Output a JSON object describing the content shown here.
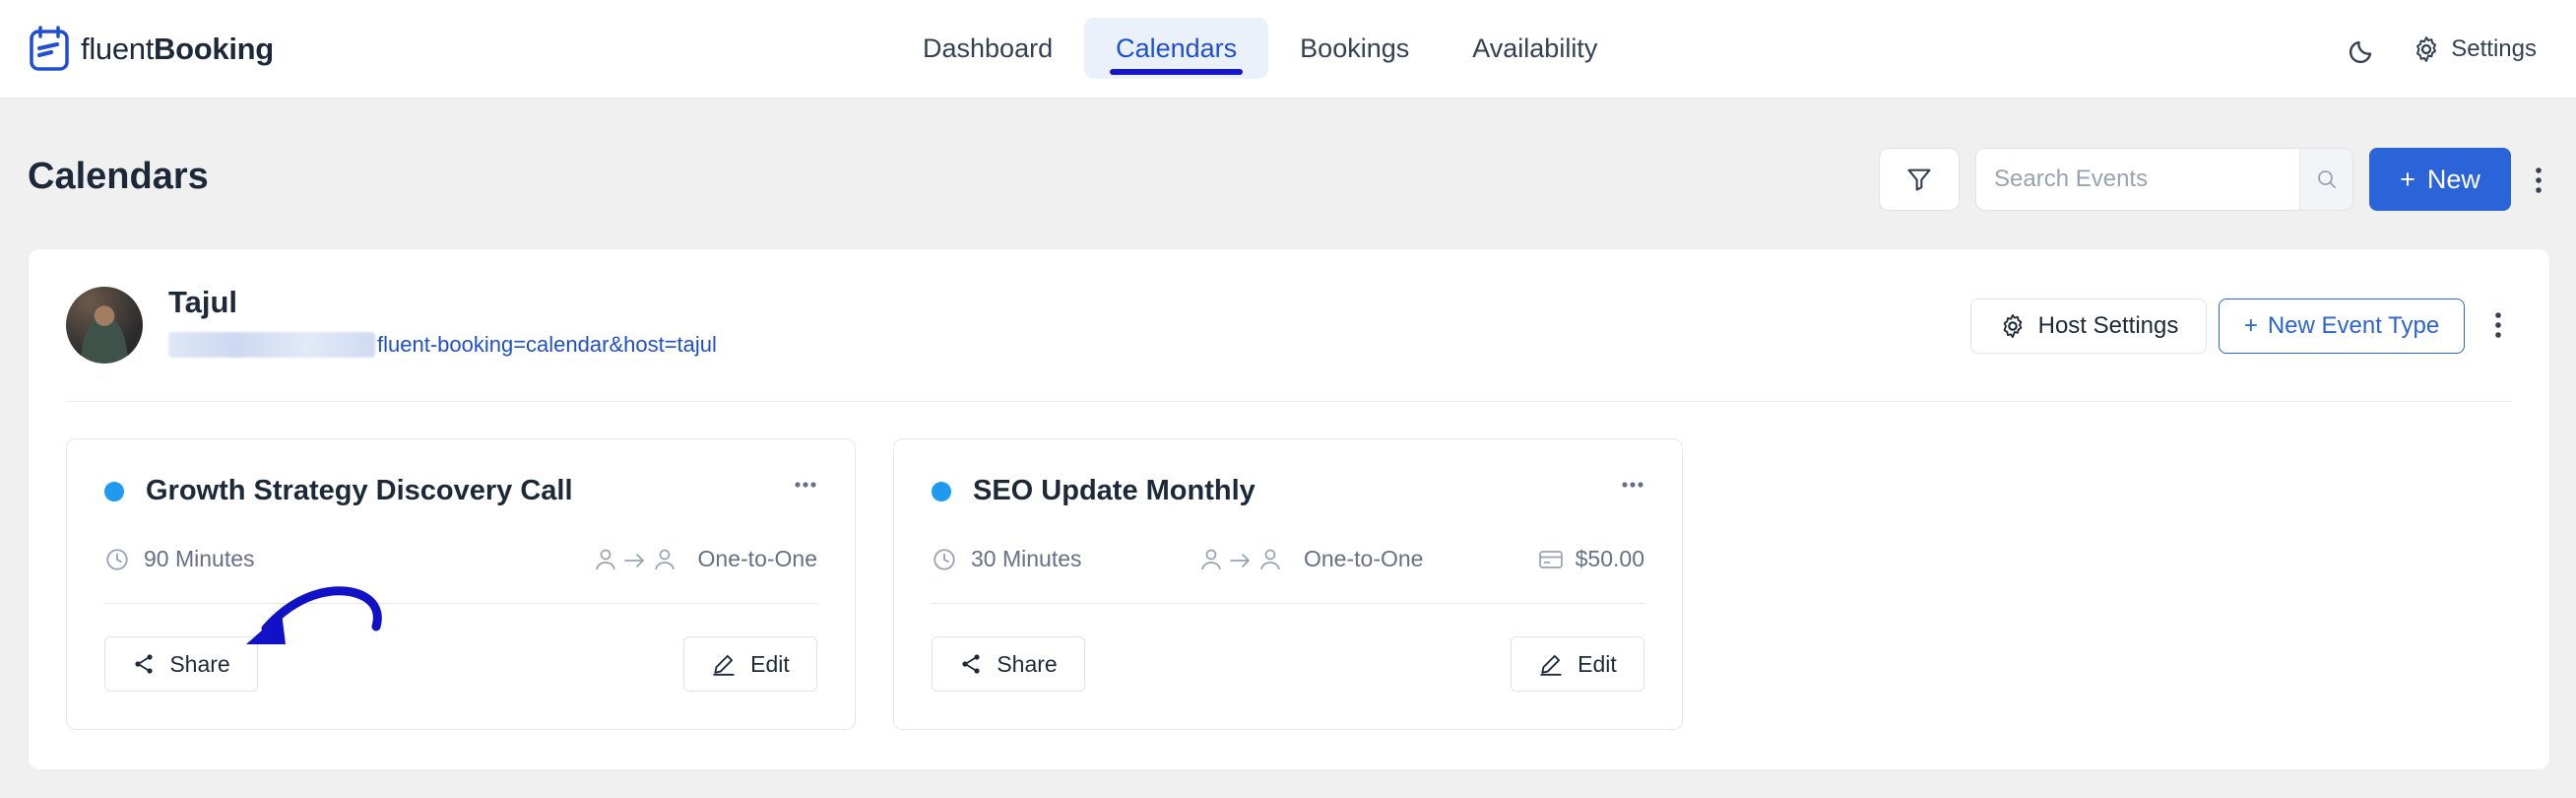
{
  "brand": {
    "light": "fluent",
    "bold": "Booking"
  },
  "nav": [
    {
      "label": "Dashboard",
      "active": false
    },
    {
      "label": "Calendars",
      "active": true
    },
    {
      "label": "Bookings",
      "active": false
    },
    {
      "label": "Availability",
      "active": false
    }
  ],
  "topbar": {
    "settings_label": "Settings",
    "theme_icon": "moon-icon"
  },
  "page": {
    "title": "Calendars",
    "search_placeholder": "Search Events",
    "new_label": "New"
  },
  "host": {
    "name": "Tajul",
    "url_visible": "fluent-booking=calendar&host=tajul",
    "host_settings_label": "Host Settings",
    "new_event_type_label": "New Event Type"
  },
  "events": [
    {
      "title": "Growth Strategy Discovery Call",
      "duration": "90 Minutes",
      "type": "One-to-One",
      "price": "",
      "share_label": "Share",
      "edit_label": "Edit",
      "dot_color": "#1e9bf0"
    },
    {
      "title": "SEO Update Monthly",
      "duration": "30 Minutes",
      "type": "One-to-One",
      "price": "$50.00",
      "share_label": "Share",
      "edit_label": "Edit",
      "dot_color": "#1e9bf0"
    }
  ],
  "colors": {
    "accent": "#2b63d9",
    "active_underline": "#1717c9",
    "annotation_arrow": "#1111c8"
  }
}
